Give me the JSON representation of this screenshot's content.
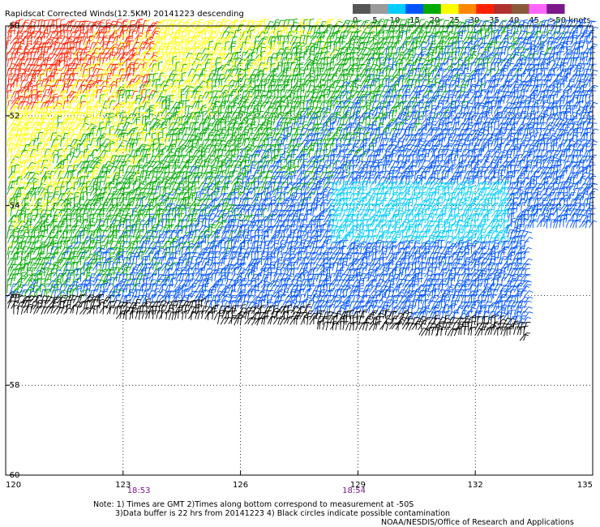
{
  "chart_data": {
    "type": "wind-barb-map",
    "title": "Rapidscat Corrected Winds(12.5KM) 20141223 descending",
    "x_ticks": [
      "120",
      "123",
      "126",
      "129",
      "132",
      "135"
    ],
    "y_ticks": [
      "-50",
      "-52",
      "-54",
      "-56",
      "-58",
      "-60"
    ],
    "xlim": [
      120,
      135
    ],
    "ylim": [
      -60,
      -50
    ],
    "grid": "dotted",
    "time_labels": [
      {
        "lon": 123.4,
        "label": "18:53"
      },
      {
        "lon": 128.9,
        "label": "18:54"
      }
    ],
    "colorbar": {
      "labels": [
        "0",
        "5",
        "10",
        "15",
        "20",
        "25",
        "30",
        "35",
        "40",
        "45",
        ">50 knots"
      ],
      "colors": [
        "#555555",
        "#9a9a9a",
        "#00ccff",
        "#0055ff",
        "#00aa00",
        "#ffff00",
        "#ff8800",
        "#ff2200",
        "#b03030",
        "#8a5a3a",
        "#ff66ff",
        "#7a1a8a"
      ]
    },
    "data_region": {
      "west_lon": 120,
      "east_lon": 135,
      "north_lat": -50,
      "south_lat_west": -56.4,
      "south_lat_east": -57.1,
      "notch_east_lon": 133.3,
      "notch_lat": -54.5
    },
    "wind_zones": [
      {
        "region": "northwest",
        "speed_knots": "30-35",
        "color": "#ff2200"
      },
      {
        "region": "north-central",
        "speed_knots": "20-25",
        "color": "#ffff00"
      },
      {
        "region": "central",
        "speed_knots": "15-20",
        "color": "#00aa00"
      },
      {
        "region": "southeast",
        "speed_knots": "10-15",
        "color": "#0055ff"
      },
      {
        "region": "east",
        "speed_knots": "5-10",
        "color": "#00ccff"
      },
      {
        "region": "southern edge",
        "speed_knots": "contaminated",
        "color": "#000000"
      }
    ]
  },
  "notes": {
    "line1": "Note: 1) Times are GMT 2)Times along bottom correspond to measurement at -50S",
    "line2": "3)Data buffer is 22 hrs from 20141223 4) Black circles indicate possible contamination",
    "credit": "NOAA/NESDIS/Office of Research and Applications"
  }
}
